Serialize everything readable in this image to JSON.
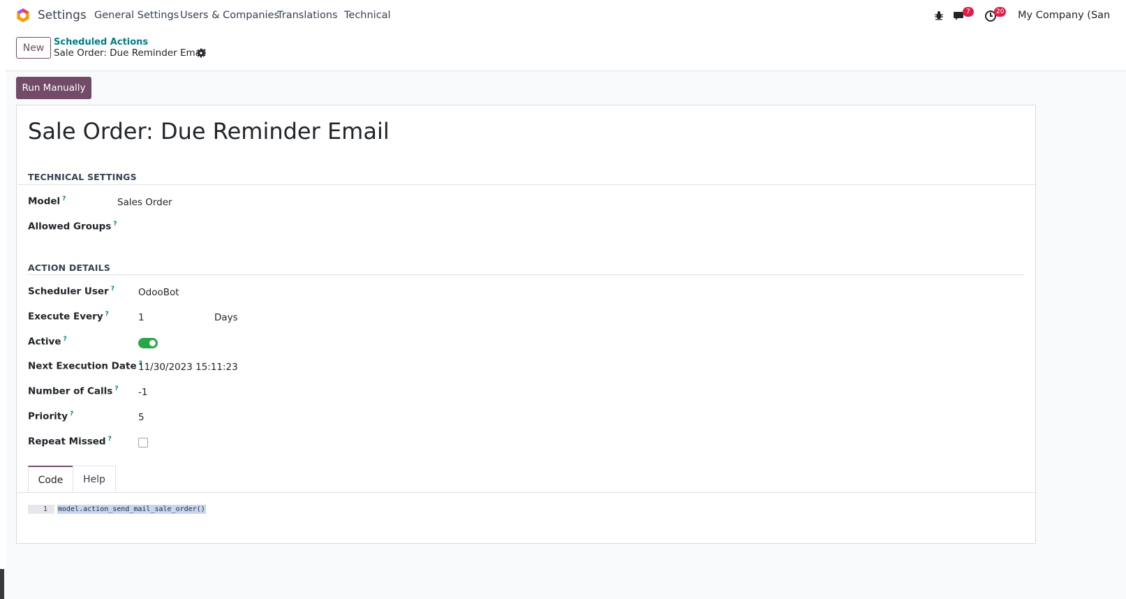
{
  "navbar": {
    "app_name": "Settings",
    "menus": [
      "General Settings",
      "Users & Companies",
      "Translations",
      "Technical"
    ],
    "messages_count": "7",
    "activities_count": "20",
    "company": "My Company (San"
  },
  "control_panel": {
    "new_label": "New",
    "breadcrumb_parent": "Scheduled Actions",
    "breadcrumb_current": "Sale Order: Due Reminder Email"
  },
  "actions": {
    "run_manually": "Run Manually"
  },
  "form": {
    "title": "Sale Order: Due Reminder Email",
    "technical_settings": {
      "heading": "TECHNICAL SETTINGS",
      "model_label": "Model",
      "model_value": "Sales Order",
      "allowed_groups_label": "Allowed Groups",
      "allowed_groups_value": ""
    },
    "action_details": {
      "heading": "ACTION DETAILS",
      "scheduler_user_label": "Scheduler User",
      "scheduler_user_value": "OdooBot",
      "execute_every_label": "Execute Every",
      "execute_every_value": "1",
      "execute_every_unit": "Days",
      "active_label": "Active",
      "active_value": true,
      "next_execution_label": "Next Execution Date",
      "next_execution_value": "11/30/2023 15:11:23",
      "number_of_calls_label": "Number of Calls",
      "number_of_calls_value": "-1",
      "priority_label": "Priority",
      "priority_value": "5",
      "repeat_missed_label": "Repeat Missed",
      "repeat_missed_value": false
    },
    "help_marker": "?",
    "tabs": [
      "Code",
      "Help"
    ],
    "code": {
      "line_number": "1",
      "line_text": "model.action_send_mail_sale_order()"
    }
  },
  "colors": {
    "brand": "#714b67",
    "link": "#017e84",
    "toggle_on": "#28a745",
    "badge": "#e11d48"
  }
}
